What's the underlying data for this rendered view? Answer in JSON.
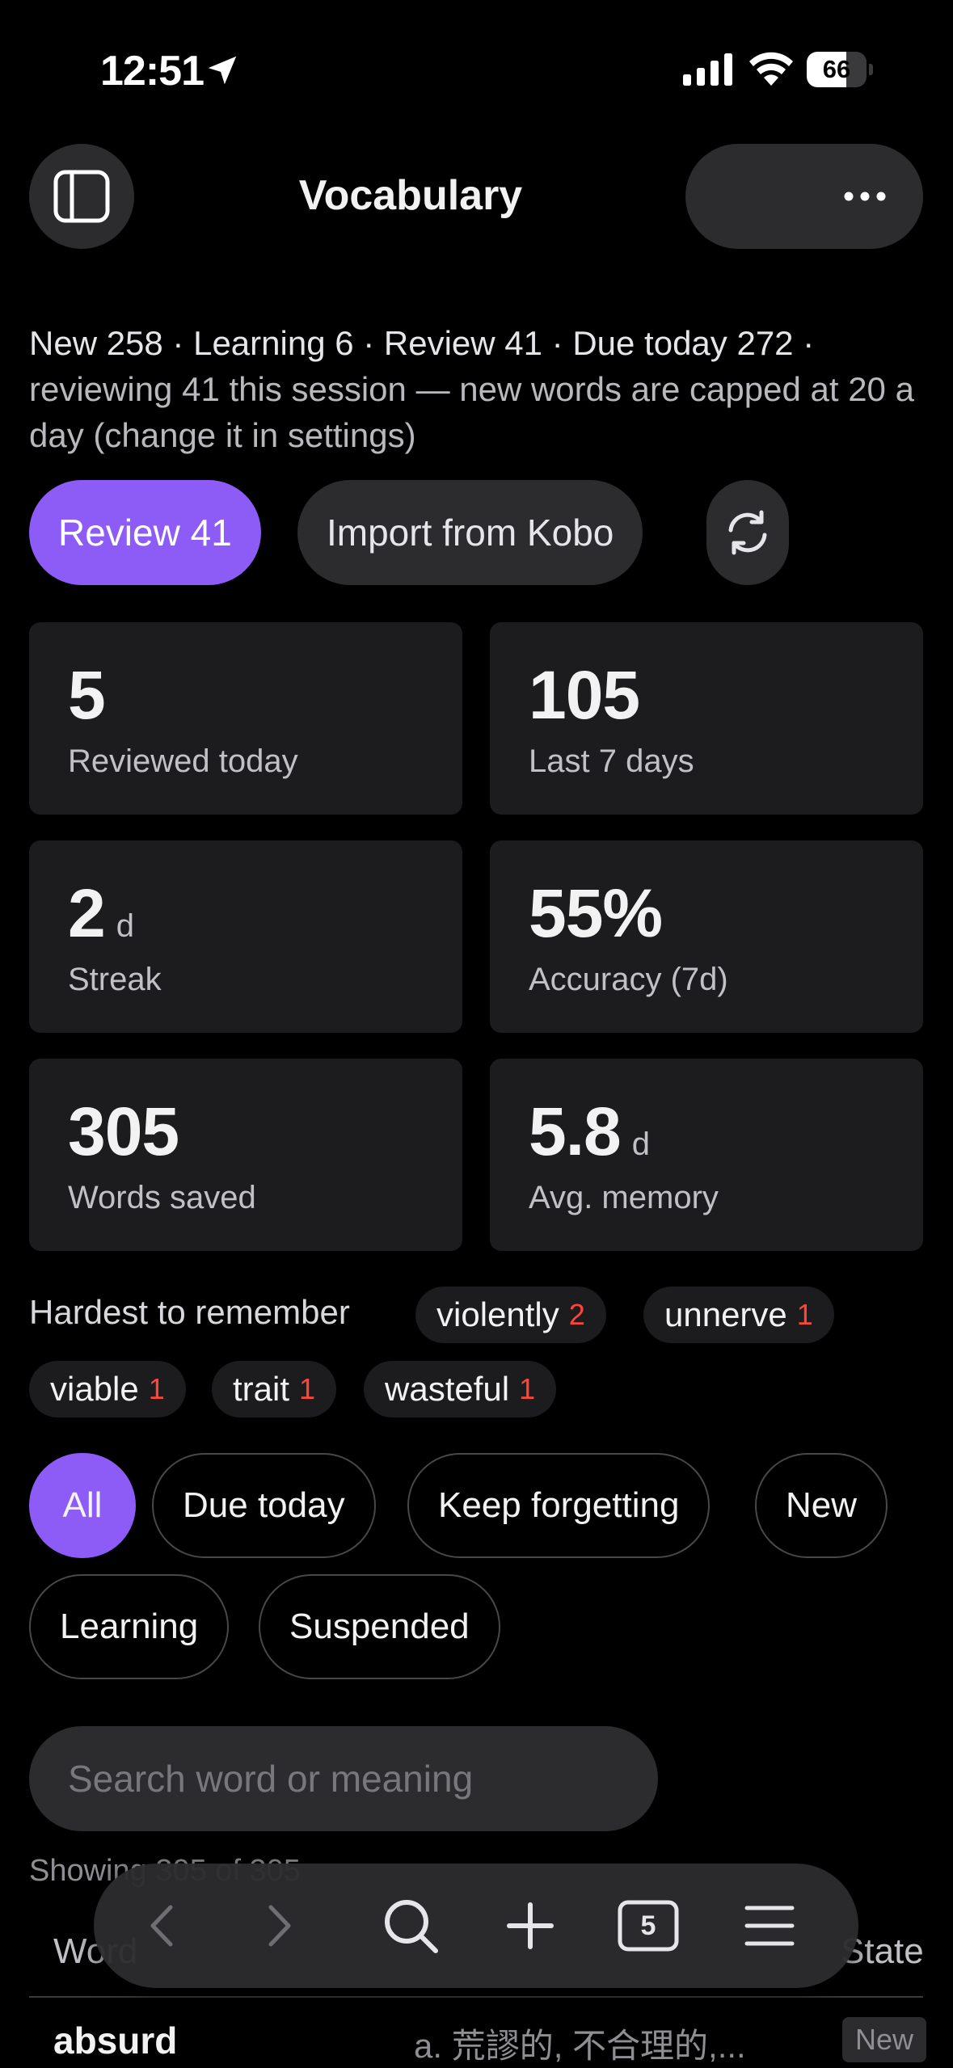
{
  "status_bar": {
    "time": "12:51",
    "battery": "66",
    "battery_level": 0.66
  },
  "header": {
    "title": "Vocabulary"
  },
  "summary": {
    "counts": "New 258 · Learning 6 · Review 41 · Due today 272 ·",
    "session_note": " reviewing 41 this session — new words are capped at 20 a day (change it in settings)"
  },
  "actions": {
    "review_label": "Review 41",
    "import_label": "Import from Kobo"
  },
  "stats": [
    {
      "value": "5",
      "unit": "",
      "label": "Reviewed today"
    },
    {
      "value": "105",
      "unit": "",
      "label": "Last 7 days"
    },
    {
      "value": "2",
      "unit": "d",
      "label": "Streak"
    },
    {
      "value": "55%",
      "unit": "",
      "label": "Accuracy (7d)"
    },
    {
      "value": "305",
      "unit": "",
      "label": "Words saved"
    },
    {
      "value": "5.8",
      "unit": "d",
      "label": "Avg. memory"
    }
  ],
  "hardest": {
    "label": "Hardest to remember",
    "words": [
      {
        "word": "violently",
        "count": "2"
      },
      {
        "word": "unnerve",
        "count": "1"
      },
      {
        "word": "viable",
        "count": "1"
      },
      {
        "word": "trait",
        "count": "1"
      },
      {
        "word": "wasteful",
        "count": "1"
      }
    ]
  },
  "filters": [
    "All",
    "Due today",
    "Keep forgetting",
    "New",
    "Learning",
    "Suspended"
  ],
  "search": {
    "placeholder": "Search word or meaning",
    "value": ""
  },
  "list": {
    "showing": "Showing 305 of 305",
    "col_word": "Word",
    "col_state": "State",
    "rows": [
      {
        "word": "absurd",
        "meaning": "a. 荒謬的, 不合理的,...",
        "state": "New"
      }
    ]
  },
  "toolbar": {
    "tab_count": "5"
  },
  "colors": {
    "accent": "#8d5cf6",
    "chip_count": "#ff453a",
    "background": "#000000"
  }
}
